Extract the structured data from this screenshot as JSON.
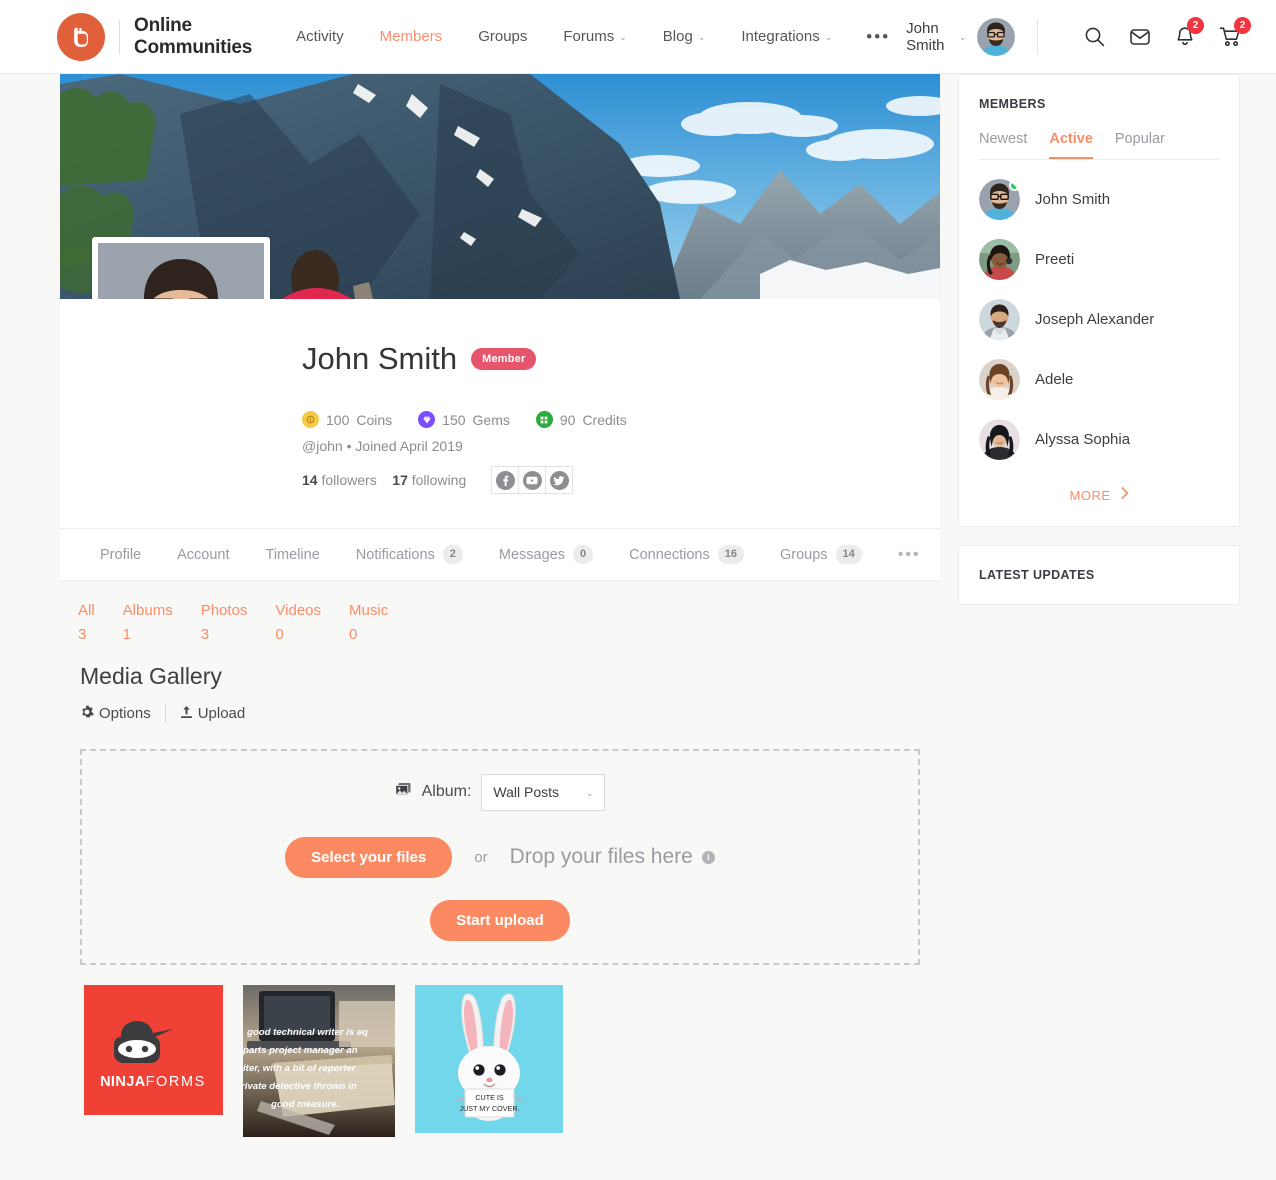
{
  "header": {
    "logo_icon": "buddyboss-logo-icon",
    "logo_line1": "Online",
    "logo_line2": "Communities",
    "nav": [
      {
        "label": "Activity",
        "has_caret": false,
        "active": false
      },
      {
        "label": "Members",
        "has_caret": false,
        "active": true
      },
      {
        "label": "Groups",
        "has_caret": false,
        "active": false
      },
      {
        "label": "Forums",
        "has_caret": true,
        "active": false
      },
      {
        "label": "Blog",
        "has_caret": true,
        "active": false
      },
      {
        "label": "Integrations",
        "has_caret": true,
        "active": false
      }
    ],
    "nav_overflow": "•••",
    "user_name": "John Smith",
    "user_caret": "⌄",
    "icons": [
      {
        "name": "search-icon",
        "badge": null
      },
      {
        "name": "inbox-icon",
        "badge": null
      },
      {
        "name": "bell-icon",
        "badge": "2"
      },
      {
        "name": "cart-icon",
        "badge": "2"
      }
    ]
  },
  "profile": {
    "cover_alt": "mountain-cliff-cover-photo",
    "avatar_alt": "john-smith-avatar",
    "name": "John Smith",
    "badge": "Member",
    "currencies": [
      {
        "icon": "coin-icon",
        "value": "100",
        "label": "Coins",
        "color": "#f7c948"
      },
      {
        "icon": "gem-icon",
        "value": "150",
        "label": "Gems",
        "color": "#7c4dff"
      },
      {
        "icon": "credit-icon",
        "value": "90",
        "label": "Credits",
        "color": "#2eab3f"
      }
    ],
    "handle": "@john",
    "joined": "Joined April 2019",
    "meta_sep": "•",
    "followers_count": "14",
    "followers_label": "followers",
    "following_count": "17",
    "following_label": "following",
    "socials": [
      {
        "name": "facebook-icon",
        "glyph": "f"
      },
      {
        "name": "youtube-icon",
        "glyph": "▶"
      },
      {
        "name": "twitter-icon",
        "glyph": "🐦"
      }
    ],
    "tabs": [
      {
        "label": "Profile",
        "count": null
      },
      {
        "label": "Account",
        "count": null
      },
      {
        "label": "Timeline",
        "count": null
      },
      {
        "label": "Notifications",
        "count": "2"
      },
      {
        "label": "Messages",
        "count": "0"
      },
      {
        "label": "Connections",
        "count": "16"
      },
      {
        "label": "Groups",
        "count": "14"
      }
    ],
    "tabs_overflow": "•••"
  },
  "media": {
    "filters": [
      {
        "label": "All",
        "count": "3"
      },
      {
        "label": "Albums",
        "count": "1"
      },
      {
        "label": "Photos",
        "count": "3"
      },
      {
        "label": "Videos",
        "count": "0"
      },
      {
        "label": "Music",
        "count": "0"
      }
    ],
    "gallery_title": "Media Gallery",
    "options_label": "Options",
    "options_icon": "gear-icon",
    "upload_label": "Upload",
    "upload_icon": "upload-icon",
    "dropzone": {
      "album_icon": "images-icon",
      "album_label": "Album:",
      "album_value": "Wall Posts",
      "album_caret": "⌄",
      "select_files_label": "Select your files",
      "or_label": "or",
      "drop_label": "Drop your files here",
      "info_icon": "info-icon",
      "info_glyph": "i",
      "start_upload_label": "Start upload"
    },
    "thumbnails": [
      {
        "name": "ninja-forms-thumbnail",
        "text_bold": "NINJA",
        "text_light": "FORMS"
      },
      {
        "name": "technical-writer-quote-thumbnail",
        "lines": [
          "good technical writer is eq",
          "parts project manager an",
          "iter, with a bit of reporter",
          "rivate detective thrown in",
          "good measure."
        ]
      },
      {
        "name": "cute-bunny-thumbnail",
        "sign_line1": "CUTE IS",
        "sign_line2": "JUST MY COVER."
      }
    ]
  },
  "sidebar": {
    "members_widget": {
      "title": "MEMBERS",
      "tabs": [
        {
          "label": "Newest",
          "active": false
        },
        {
          "label": "Active",
          "active": true
        },
        {
          "label": "Popular",
          "active": false
        }
      ],
      "members": [
        {
          "name": "John Smith",
          "online": true,
          "avatar": "john-smith-avatar"
        },
        {
          "name": "Preeti",
          "online": false,
          "avatar": "preeti-avatar"
        },
        {
          "name": "Joseph Alexander",
          "online": false,
          "avatar": "joseph-alexander-avatar"
        },
        {
          "name": "Adele",
          "online": false,
          "avatar": "adele-avatar"
        },
        {
          "name": "Alyssa Sophia",
          "online": false,
          "avatar": "alyssa-sophia-avatar"
        }
      ],
      "more_label": "MORE",
      "more_icon": "chevron-right-icon"
    },
    "latest_updates_widget": {
      "title": "LATEST UPDATES"
    }
  },
  "colors": {
    "accent": "#fa8c68",
    "brand_orange": "#e0603c",
    "badge_red": "#f1343d",
    "member_badge": "#e8546b",
    "online_green": "#27cb54",
    "page_bg": "#f8f8f7"
  }
}
